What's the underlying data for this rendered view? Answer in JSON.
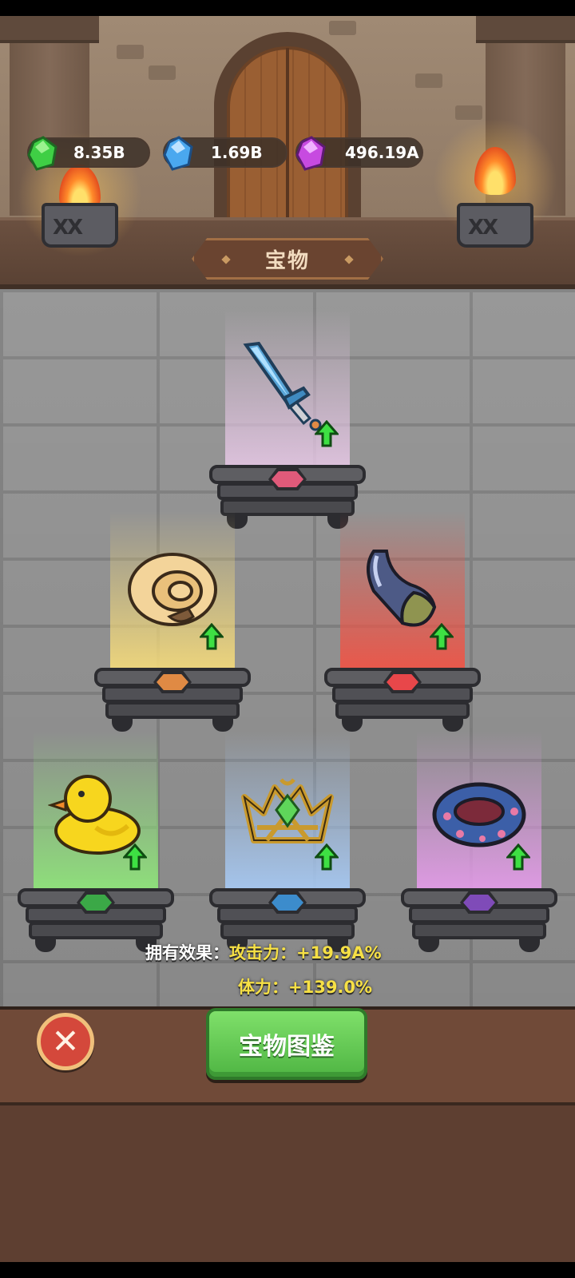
{
  "currencies": [
    {
      "name": "green-gem",
      "value": "8.35B",
      "color": "#3fcf45"
    },
    {
      "name": "blue-gem",
      "value": "1.69B",
      "color": "#4aa8ef"
    },
    {
      "name": "purple-gem",
      "value": "496.19A",
      "color": "#c74ae0"
    }
  ],
  "title": "宝物",
  "treasures": [
    {
      "name": "ice-sword",
      "rarity_color": "#e05a7a",
      "beam_color": "#e9c9e8",
      "upgradable": true
    },
    {
      "name": "ammonite-shell",
      "rarity_color": "#e08a44",
      "beam_color": "#f7dc7a",
      "upgradable": true
    },
    {
      "name": "horn-vial",
      "rarity_color": "#e8474a",
      "beam_color": "#ef5446",
      "upgradable": true
    },
    {
      "name": "rubber-duck",
      "rarity_color": "#3ba847",
      "beam_color": "#8fe47a",
      "upgradable": true
    },
    {
      "name": "golden-crown",
      "rarity_color": "#3c8ccc",
      "beam_color": "#a6c8f2",
      "upgradable": true
    },
    {
      "name": "swim-ring",
      "rarity_color": "#7f4bb8",
      "beam_color": "#e39be8",
      "upgradable": true
    }
  ],
  "effects": {
    "label": "拥有效果：",
    "attack": "攻击力：+19.9A%",
    "stamina": "体力：+139.0%"
  },
  "buttons": {
    "close": "✕",
    "codex": "宝物图鉴"
  }
}
